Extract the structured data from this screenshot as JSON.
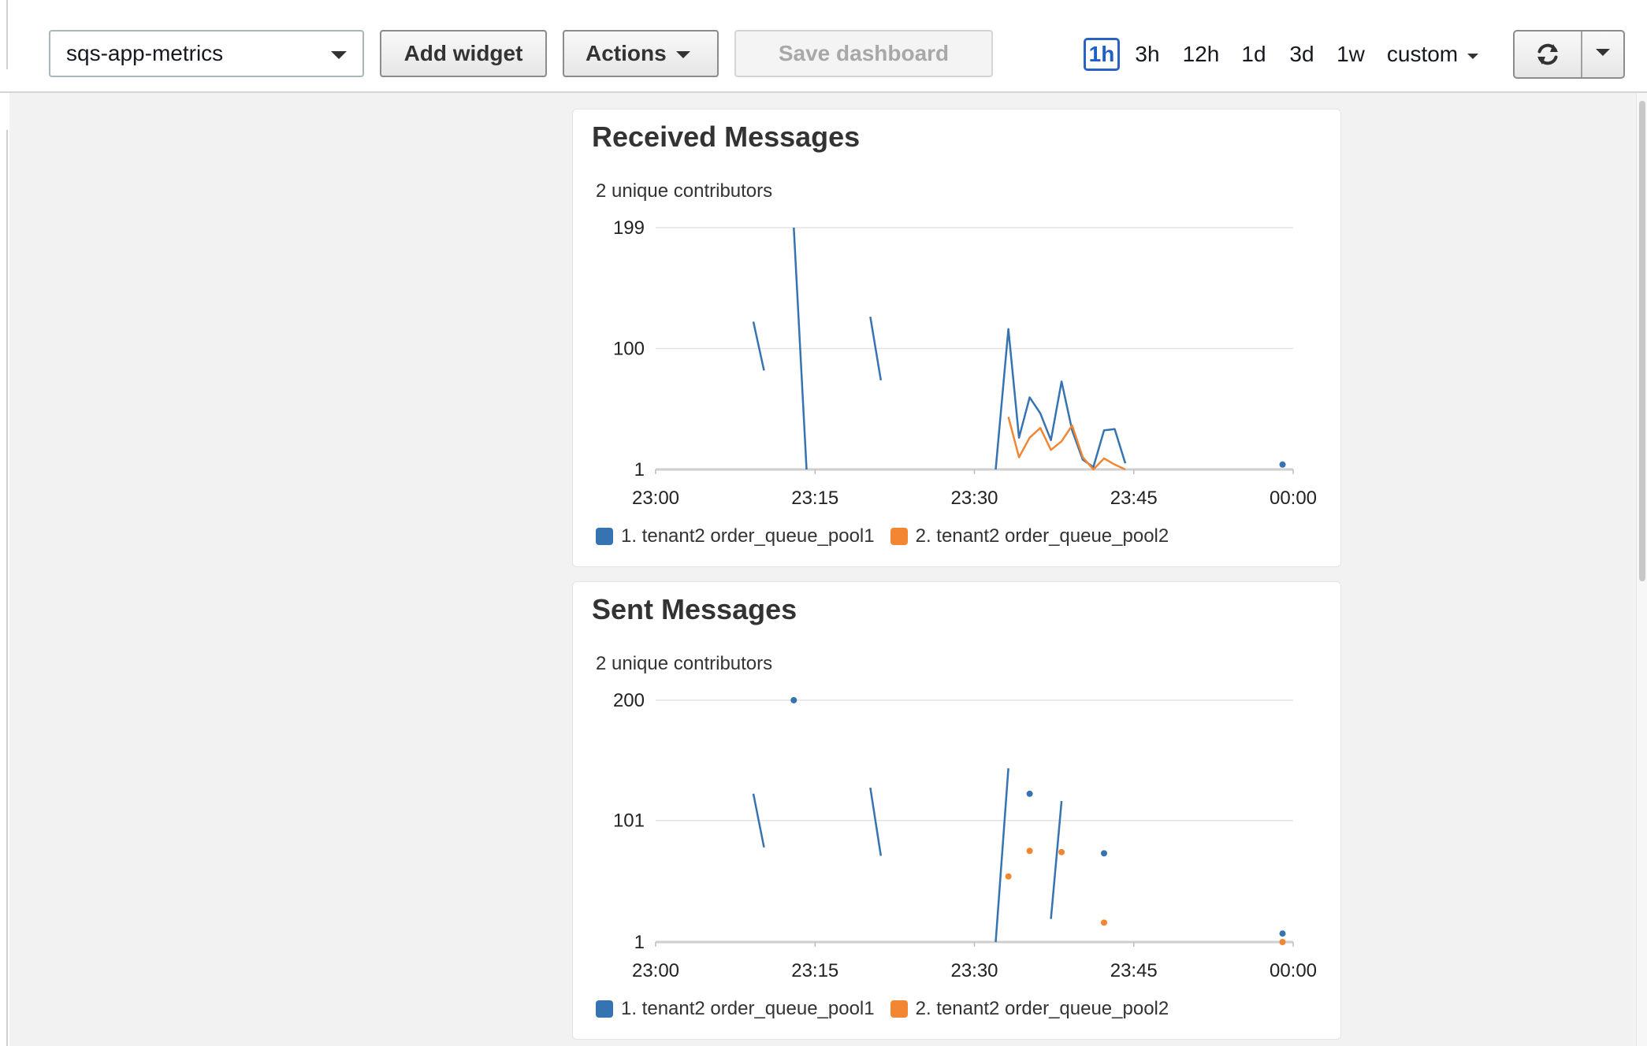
{
  "toolbar": {
    "dashboard_name": "sqs-app-metrics",
    "add_widget": "Add widget",
    "actions": "Actions",
    "save_dashboard": "Save dashboard",
    "ranges": [
      "1h",
      "3h",
      "12h",
      "1d",
      "3d",
      "1w"
    ],
    "active_range": "1h",
    "custom": "custom",
    "refresh_icon": "refresh-icon",
    "menu_icon": "chevron-down-icon"
  },
  "colors": {
    "series1": "#3573b1",
    "series2": "#f28633",
    "active_range": "#1f5fc6",
    "grid": "#e3e3e3",
    "axis": "#cfcfcf"
  },
  "widgets": [
    {
      "title": "Received Messages",
      "subtitle": "2 unique contributors",
      "legend": [
        "1. tenant2 order_queue_pool1",
        "2. tenant2 order_queue_pool2"
      ]
    },
    {
      "title": "Sent Messages",
      "subtitle": "2 unique contributors",
      "legend": [
        "1. tenant2 order_queue_pool1",
        "2. tenant2 order_queue_pool2"
      ]
    }
  ],
  "chart_data": [
    {
      "type": "line",
      "title": "Received Messages",
      "subtitle": "2 unique contributors",
      "x_ticks": [
        "23:00",
        "23:15",
        "23:30",
        "23:45",
        "00:00"
      ],
      "y_ticks": [
        1,
        100,
        199
      ],
      "ylim": [
        1,
        199
      ],
      "x_range_minutes": [
        0,
        60
      ],
      "grid": true,
      "legend_position": "bottom-left",
      "series": [
        {
          "name": "1. tenant2 order_queue_pool1",
          "color": "#3573b1",
          "segments": [
            [
              [
                9.2,
                122
              ],
              [
                10.2,
                82
              ]
            ],
            [
              [
                13.0,
                199
              ],
              [
                14.2,
                1
              ]
            ],
            [
              [
                20.2,
                126
              ],
              [
                21.2,
                74
              ]
            ],
            [
              [
                32.0,
                1
              ],
              [
                33.2,
                116
              ],
              [
                34.2,
                27
              ],
              [
                35.2,
                60
              ],
              [
                36.2,
                47
              ],
              [
                37.2,
                25
              ],
              [
                38.2,
                73
              ],
              [
                39.2,
                33
              ],
              [
                40.2,
                9
              ],
              [
                41.2,
                3
              ],
              [
                42.2,
                33
              ],
              [
                43.2,
                34
              ],
              [
                44.2,
                6
              ]
            ]
          ],
          "points": [
            [
              59.0,
              5
            ]
          ]
        },
        {
          "name": "2. tenant2 order_queue_pool2",
          "color": "#f28633",
          "segments": [
            [
              [
                33.2,
                44
              ],
              [
                34.2,
                11
              ],
              [
                35.2,
                27
              ],
              [
                36.2,
                35
              ],
              [
                37.2,
                17
              ],
              [
                38.2,
                24
              ],
              [
                39.2,
                37
              ],
              [
                40.2,
                11
              ],
              [
                41.2,
                1
              ],
              [
                42.2,
                10
              ],
              [
                43.2,
                5
              ],
              [
                44.2,
                1
              ]
            ]
          ],
          "points": []
        }
      ]
    },
    {
      "type": "line",
      "title": "Sent Messages",
      "subtitle": "2 unique contributors",
      "x_ticks": [
        "23:00",
        "23:15",
        "23:30",
        "23:45",
        "00:00"
      ],
      "y_ticks": [
        1,
        101,
        200
      ],
      "ylim": [
        1,
        200
      ],
      "x_range_minutes": [
        0,
        60
      ],
      "grid": true,
      "legend_position": "bottom-left",
      "series": [
        {
          "name": "1. tenant2 order_queue_pool1",
          "color": "#3573b1",
          "segments": [
            [
              [
                9.2,
                123
              ],
              [
                10.2,
                79
              ]
            ],
            [
              [
                20.2,
                128
              ],
              [
                21.2,
                72
              ]
            ],
            [
              [
                32.0,
                1
              ],
              [
                33.2,
                144
              ]
            ],
            [
              [
                37.2,
                20
              ],
              [
                38.2,
                117
              ]
            ]
          ],
          "points": [
            [
              13.0,
              200
            ],
            [
              35.2,
              123
            ],
            [
              42.2,
              74
            ],
            [
              59.0,
              8
            ]
          ]
        },
        {
          "name": "2. tenant2 order_queue_pool2",
          "color": "#f28633",
          "segments": [],
          "points": [
            [
              33.2,
              55
            ],
            [
              35.2,
              76
            ],
            [
              38.2,
              75
            ],
            [
              42.2,
              17
            ],
            [
              59.0,
              1
            ]
          ]
        }
      ]
    }
  ]
}
